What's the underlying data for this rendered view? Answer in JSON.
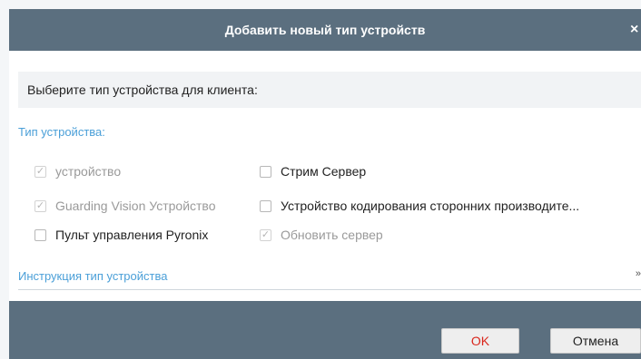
{
  "dialog": {
    "title": "Добавить новый тип устройств",
    "close_icon": "×"
  },
  "content": {
    "instruction": "Выберите тип устройства для клиента:",
    "type_label": "Тип устройства:",
    "device_types": [
      {
        "label": "устройство",
        "checked": true,
        "disabled": true
      },
      {
        "label": "Стрим Сервер",
        "checked": false,
        "disabled": false
      },
      {
        "label": "Guarding Vision Устройство",
        "checked": true,
        "disabled": true
      },
      {
        "label": "Устройство кодирования сторонних производите...",
        "checked": false,
        "disabled": false
      },
      {
        "label": "Пульт управления Pyronix",
        "checked": false,
        "disabled": false
      },
      {
        "label": "Обновить сервер",
        "checked": true,
        "disabled": true
      }
    ],
    "instruction_link": "Инструкция тип устройства",
    "expand_icon": "»"
  },
  "footer": {
    "ok_label": "OK",
    "cancel_label": "Отмена"
  }
}
